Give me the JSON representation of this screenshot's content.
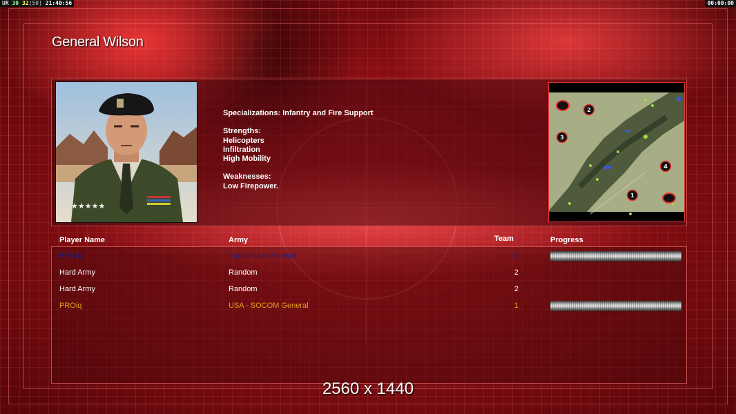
{
  "hud": {
    "left_prefix": "UR",
    "fps_min": "30",
    "fps_cur": "32",
    "fps_cap": "[50]",
    "clock": "21:40:56",
    "timer": "00:00:00"
  },
  "general": {
    "name": "General Wilson",
    "specializations": "Specializations: Infantry and Fire Support",
    "strengths_title": "Strengths:",
    "strengths": [
      "Helicopters",
      "Infiltration",
      "High Mobility"
    ],
    "weaknesses_title": "Weaknesses:",
    "weaknesses": [
      "Low Firepower."
    ]
  },
  "minimap": {
    "markers": [
      "2",
      "3",
      "4",
      "1"
    ]
  },
  "table": {
    "headers": {
      "player": "Player Name",
      "army": "Army",
      "team": "Team",
      "progress": "Progress"
    },
    "rows": [
      {
        "name": "PROiq",
        "army": "Cyrat Nuke General",
        "team": "1",
        "color": "#1a1f8a",
        "has_progress": true
      },
      {
        "name": "Hard Army",
        "army": "Random",
        "team": "2",
        "color": "#ffffff",
        "has_progress": false
      },
      {
        "name": "Hard Army",
        "army": "Random",
        "team": "2",
        "color": "#ffffff",
        "has_progress": false
      },
      {
        "name": "PROiq",
        "army": "USA - SOCOM General",
        "team": "1",
        "color": "#e8a21f",
        "has_progress": true
      }
    ]
  },
  "resolution": "2560 x 1440",
  "colors": {
    "accent_red": "#b3161d",
    "frame": "#ff7878"
  }
}
